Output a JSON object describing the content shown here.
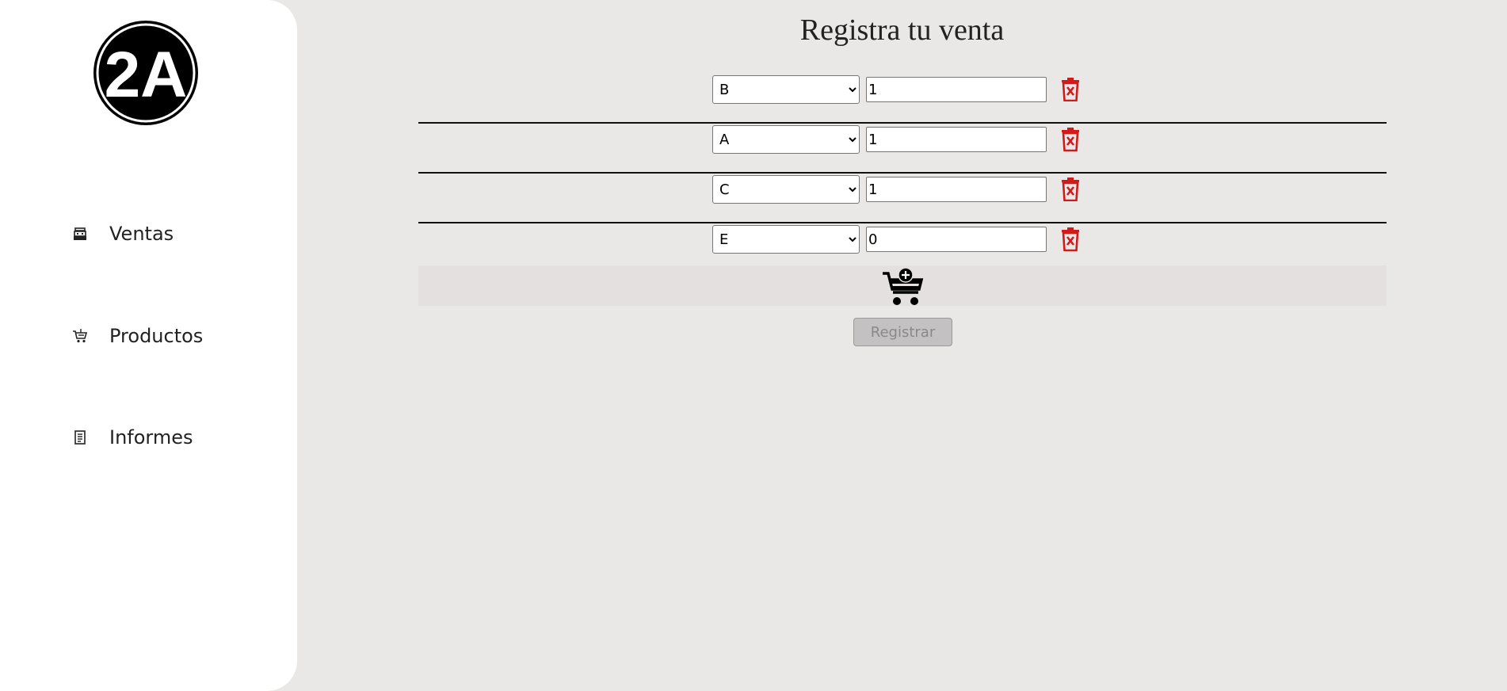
{
  "sidebar": {
    "logo_text": "2A",
    "items": [
      {
        "label": "Ventas",
        "icon": "cash-register-icon"
      },
      {
        "label": "Productos",
        "icon": "cart-icon"
      },
      {
        "label": "Informes",
        "icon": "report-icon"
      }
    ]
  },
  "main": {
    "title": "Registra tu venta",
    "rows": [
      {
        "product": "B",
        "quantity": "1"
      },
      {
        "product": "A",
        "quantity": "1"
      },
      {
        "product": "C",
        "quantity": "1"
      },
      {
        "product": "E",
        "quantity": "0"
      }
    ],
    "add_icon": "cart-plus-icon",
    "delete_icon": "trash-x-icon",
    "register_label": "Registrar"
  },
  "colors": {
    "background": "#eae8e7",
    "sidebar": "#ffffff",
    "delete": "#d11a1a",
    "add_bar": "#e4e0df",
    "register_disabled": "#c3c1c1"
  }
}
